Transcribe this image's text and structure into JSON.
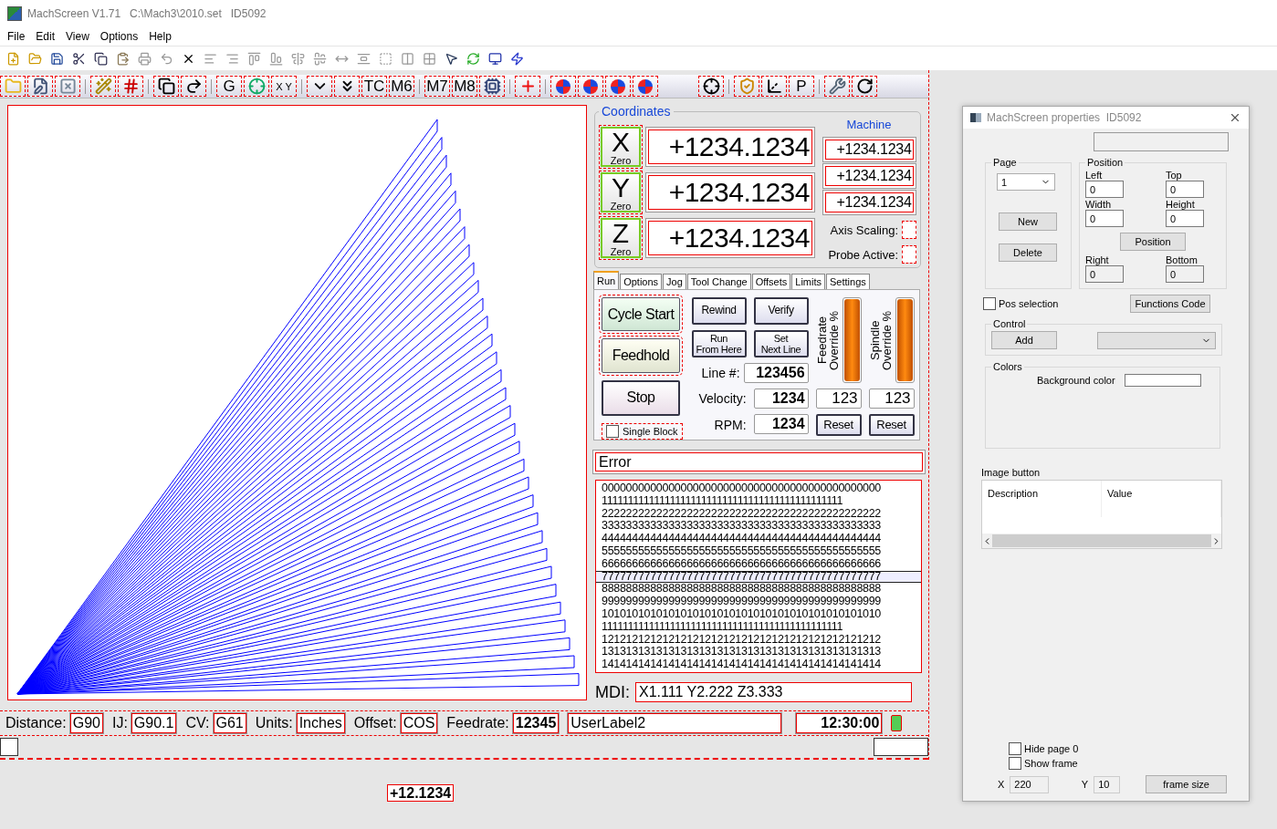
{
  "window": {
    "title": "MachScreen V1.71   C:\\Mach3\\2010.set   ID5092"
  },
  "menu": [
    {
      "label": "File"
    },
    {
      "label": "Edit"
    },
    {
      "label": "View"
    },
    {
      "label": "Options"
    },
    {
      "label": "Help"
    }
  ],
  "screen_toolbar": {
    "labels": [
      "G",
      "X",
      "Y",
      "TC",
      "M6",
      "M7",
      "M8",
      "P"
    ]
  },
  "coordinates": {
    "title": "Coordinates",
    "machine_title": "Machine",
    "axis_scaling": "Axis Scaling:",
    "probe_active": "Probe Active:",
    "axes": [
      {
        "letter": "X",
        "zero": "Zero",
        "value": "+1234.1234",
        "machine": "+1234.1234"
      },
      {
        "letter": "Y",
        "zero": "Zero",
        "value": "+1234.1234",
        "machine": "+1234.1234"
      },
      {
        "letter": "Z",
        "zero": "Zero",
        "value": "+1234.1234",
        "machine": "+1234.1234"
      }
    ]
  },
  "tabs": [
    {
      "label": "Run",
      "selected": true
    },
    {
      "label": "Options",
      "selected": false
    },
    {
      "label": "Jog",
      "selected": false
    },
    {
      "label": "Tool Change",
      "selected": false
    },
    {
      "label": "Offsets",
      "selected": false
    },
    {
      "label": "Limits",
      "selected": false
    },
    {
      "label": "Settings",
      "selected": false
    }
  ],
  "run": {
    "cycle_start": "Cycle Start",
    "feedhold": "Feedhold",
    "stop": "Stop",
    "rewind": "Rewind",
    "verify": "Verify",
    "run_from_here": "Run\nFrom Here",
    "set_next_line": "Set\nNext Line",
    "single_block": {
      "label": "Single Block",
      "checked": false
    },
    "line": {
      "label": "Line #:",
      "value": "123456"
    },
    "velocity": {
      "label": "Velocity:",
      "value": "1234"
    },
    "rpm": {
      "label": "RPM:",
      "value": "1234"
    },
    "overrides": [
      {
        "label": "Feedrate\nOverride %",
        "level": 1,
        "value": "123",
        "reset": "Reset"
      },
      {
        "label": "Spindle\nOverride %",
        "level": 1,
        "value": "123",
        "reset": "Reset"
      }
    ]
  },
  "error": "Error",
  "gcode_lines": [
    {
      "text": "0000000000000000000000000000000000000000000000",
      "selected": false
    },
    {
      "text": "1111111111111111111111111111111111111111111111",
      "selected": false
    },
    {
      "text": "2222222222222222222222222222222222222222222222",
      "selected": false
    },
    {
      "text": "3333333333333333333333333333333333333333333333",
      "selected": false
    },
    {
      "text": "4444444444444444444444444444444444444444444444",
      "selected": false
    },
    {
      "text": "5555555555555555555555555555555555555555555555",
      "selected": false
    },
    {
      "text": "6666666666666666666666666666666666666666666666",
      "selected": false
    },
    {
      "text": "7777777777777777777777777777777777777777777777",
      "selected": true
    },
    {
      "text": "8888888888888888888888888888888888888888888888",
      "selected": false
    },
    {
      "text": "9999999999999999999999999999999999999999999999",
      "selected": false
    },
    {
      "text": "1010101010101010101010101010101010101010101010",
      "selected": false
    },
    {
      "text": "1111111111111111111111111111111111111111111111",
      "selected": false
    },
    {
      "text": "1212121212121212121212121212121212121212121212",
      "selected": false
    },
    {
      "text": "1313131313131313131313131313131313131313131313",
      "selected": false
    },
    {
      "text": "1414141414141414141414141414141414141414141414",
      "selected": false
    }
  ],
  "mdi": {
    "label": "MDI:",
    "value": "X1.111 Y2.222 Z3.333"
  },
  "status_bar": {
    "fields": [
      {
        "label": "Distance:",
        "value": "G90"
      },
      {
        "label": "IJ:",
        "value": "G90.1"
      },
      {
        "label": "CV:",
        "value": "G61"
      },
      {
        "label": "Units:",
        "value": "Inches"
      },
      {
        "label": "Offset:",
        "value": "COS"
      },
      {
        "label": "Feedrate:",
        "value": "12345"
      }
    ],
    "user_label": "UserLabel2",
    "clock": "12:30:00"
  },
  "floating_dro": "+12.1234",
  "properties": {
    "title": "MachScreen properties  ID5092",
    "page": {
      "title": "Page",
      "value": "1",
      "new": "New",
      "delete": "Delete"
    },
    "position": {
      "title": "Position",
      "fields": [
        {
          "label": "Left",
          "value": "0"
        },
        {
          "label": "Top",
          "value": "0"
        },
        {
          "label": "Width",
          "value": "0"
        },
        {
          "label": "Height",
          "value": "0"
        }
      ],
      "button": "Position",
      "bottom_fields": [
        {
          "label": "Right",
          "value": "0"
        },
        {
          "label": "Bottom",
          "value": "0"
        }
      ]
    },
    "pos_selection": {
      "label": "Pos selection",
      "checked": false
    },
    "functions_code": "Functions Code",
    "control": {
      "title": "Control",
      "add": "Add"
    },
    "colors": {
      "title": "Colors",
      "background_label": "Background color"
    },
    "image_button": {
      "title": "Image button",
      "columns": [
        "Description",
        "Value"
      ]
    },
    "hide_page": {
      "label": "Hide page 0",
      "checked": false
    },
    "show_frame": {
      "label": "Show frame",
      "checked": false
    },
    "x": {
      "label": "X",
      "value": "220"
    },
    "y": {
      "label": "Y",
      "value": "10"
    },
    "frame_size": "frame size"
  }
}
